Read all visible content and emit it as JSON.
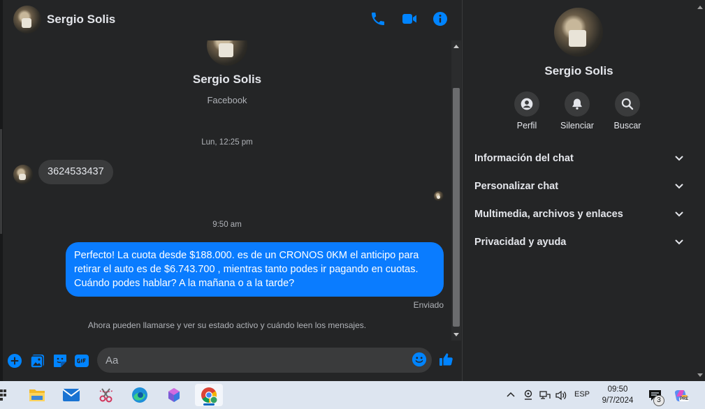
{
  "chat": {
    "header": {
      "name": "Sergio Solis"
    },
    "intro": {
      "name": "Sergio Solis",
      "subtitle": "Facebook"
    },
    "messages": [
      {
        "timestamp": "Lun, 12:25 pm",
        "direction": "incoming",
        "text": "3624533437"
      },
      {
        "timestamp": "9:50 am",
        "direction": "outgoing",
        "text": "Perfecto! La cuota desde $188.000. es de un CRONOS 0KM el anticipo para retirar el auto es de $6.743.700 , mientras tanto podes ir pagando en cuotas. Cuándo podes hablar? A la mañana o a la tarde?",
        "status": "Enviado"
      }
    ],
    "notice": "Ahora pueden llamarse y ver su estado activo y cuándo leen los mensajes.",
    "composer": {
      "placeholder": "Aa"
    }
  },
  "info_panel": {
    "name": "Sergio Solis",
    "actions": [
      {
        "label": "Perfil",
        "icon": "profile-icon"
      },
      {
        "label": "Silenciar",
        "icon": "bell-icon"
      },
      {
        "label": "Buscar",
        "icon": "search-icon"
      }
    ],
    "sections": [
      {
        "label": "Información del chat"
      },
      {
        "label": "Personalizar chat"
      },
      {
        "label": "Multimedia, archivos y enlaces"
      },
      {
        "label": "Privacidad y ayuda"
      }
    ]
  },
  "taskbar": {
    "language": "ESP",
    "time": "09:50",
    "date": "9/7/2024",
    "notification_count": "3",
    "copilot_badge": "PRE"
  },
  "colors": {
    "accent": "#0a7cff",
    "messenger_icon": "#0084ff",
    "background": "#242526",
    "bubble_incoming": "#3a3b3c",
    "text_primary": "#e4e6eb",
    "text_secondary": "#b0b3b8",
    "taskbar": "#dde5f0"
  }
}
